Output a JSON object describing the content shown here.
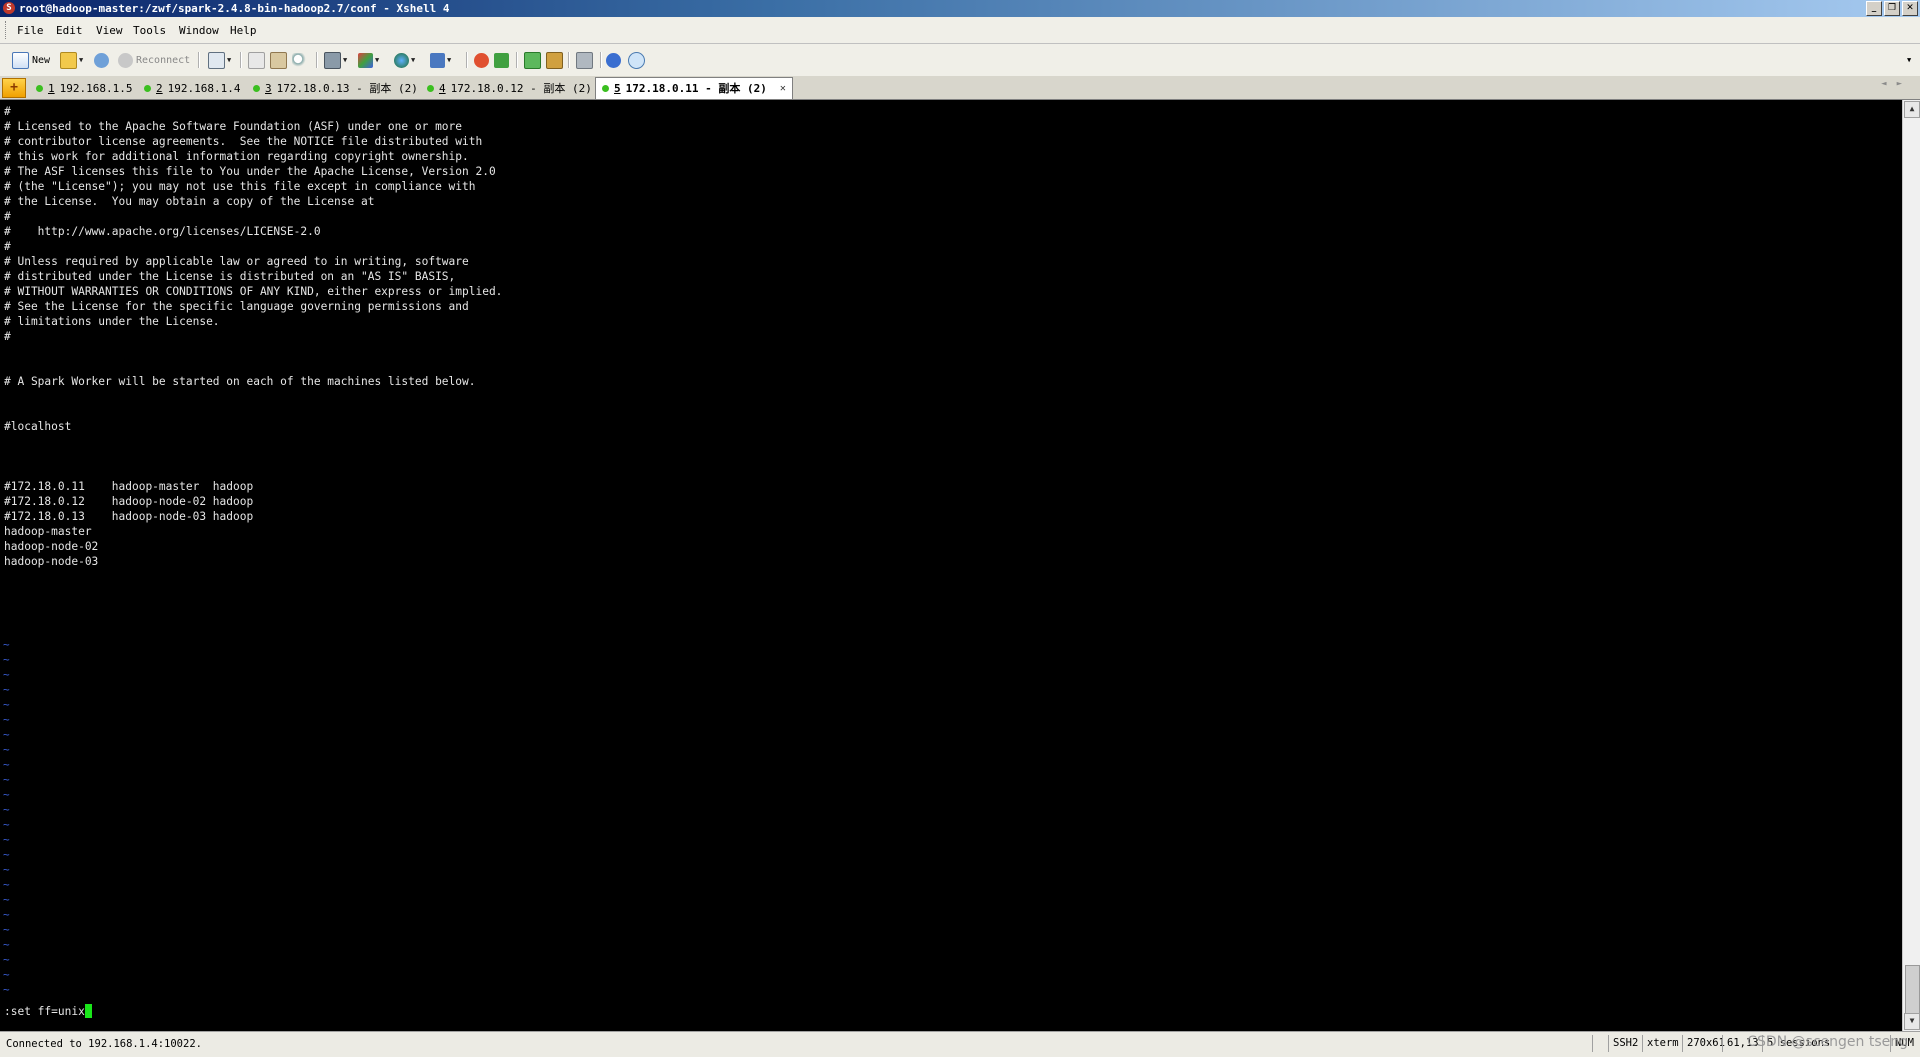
{
  "window": {
    "title": "root@hadoop-master:/zwf/spark-2.4.8-bin-hadoop2.7/conf - Xshell 4",
    "icon": "S",
    "buttons": [
      "_",
      "❐",
      "✕"
    ]
  },
  "menu": [
    "File",
    "Edit",
    "View",
    "Tools",
    "Window",
    "Help"
  ],
  "toolbar": {
    "new_label": "New",
    "reconnect_label": "Reconnect"
  },
  "tabs": [
    {
      "num": "1",
      "label": "192.168.1.5",
      "active": false
    },
    {
      "num": "2",
      "label": "192.168.1.4",
      "active": false
    },
    {
      "num": "3",
      "label": "172.18.0.13 - 副本 (2)",
      "active": false
    },
    {
      "num": "4",
      "label": "172.18.0.12 - 副本 (2)",
      "active": false
    },
    {
      "num": "5",
      "label": "172.18.0.11 - 副本 (2)",
      "active": true
    }
  ],
  "terminal": {
    "lines": [
      "#",
      "# Licensed to the Apache Software Foundation (ASF) under one or more",
      "# contributor license agreements.  See the NOTICE file distributed with",
      "# this work for additional information regarding copyright ownership.",
      "# The ASF licenses this file to You under the Apache License, Version 2.0",
      "# (the \"License\"); you may not use this file except in compliance with",
      "# the License.  You may obtain a copy of the License at",
      "#",
      "#    http://www.apache.org/licenses/LICENSE-2.0",
      "#",
      "# Unless required by applicable law or agreed to in writing, software",
      "# distributed under the License is distributed on an \"AS IS\" BASIS,",
      "# WITHOUT WARRANTIES OR CONDITIONS OF ANY KIND, either express or implied.",
      "# See the License for the specific language governing permissions and",
      "# limitations under the License.",
      "#",
      "",
      "",
      "# A Spark Worker will be started on each of the machines listed below.",
      "",
      "",
      "#localhost",
      "",
      "",
      "",
      "#172.18.0.11    hadoop-master  hadoop",
      "#172.18.0.12    hadoop-node-02 hadoop",
      "#172.18.0.13    hadoop-node-03 hadoop",
      "hadoop-master",
      "hadoop-node-02",
      "hadoop-node-03"
    ],
    "tilde": "~",
    "command": ":set ff=unix"
  },
  "status": {
    "connection": "Connected to 192.168.1.4:10022.",
    "protocol": "SSH2",
    "term": "xterm",
    "size": "270x61",
    "cursor_pos": "61,13",
    "sessions": "5 sessions",
    "num": "NUM"
  },
  "watermark": "CSDN @scengen tseng"
}
